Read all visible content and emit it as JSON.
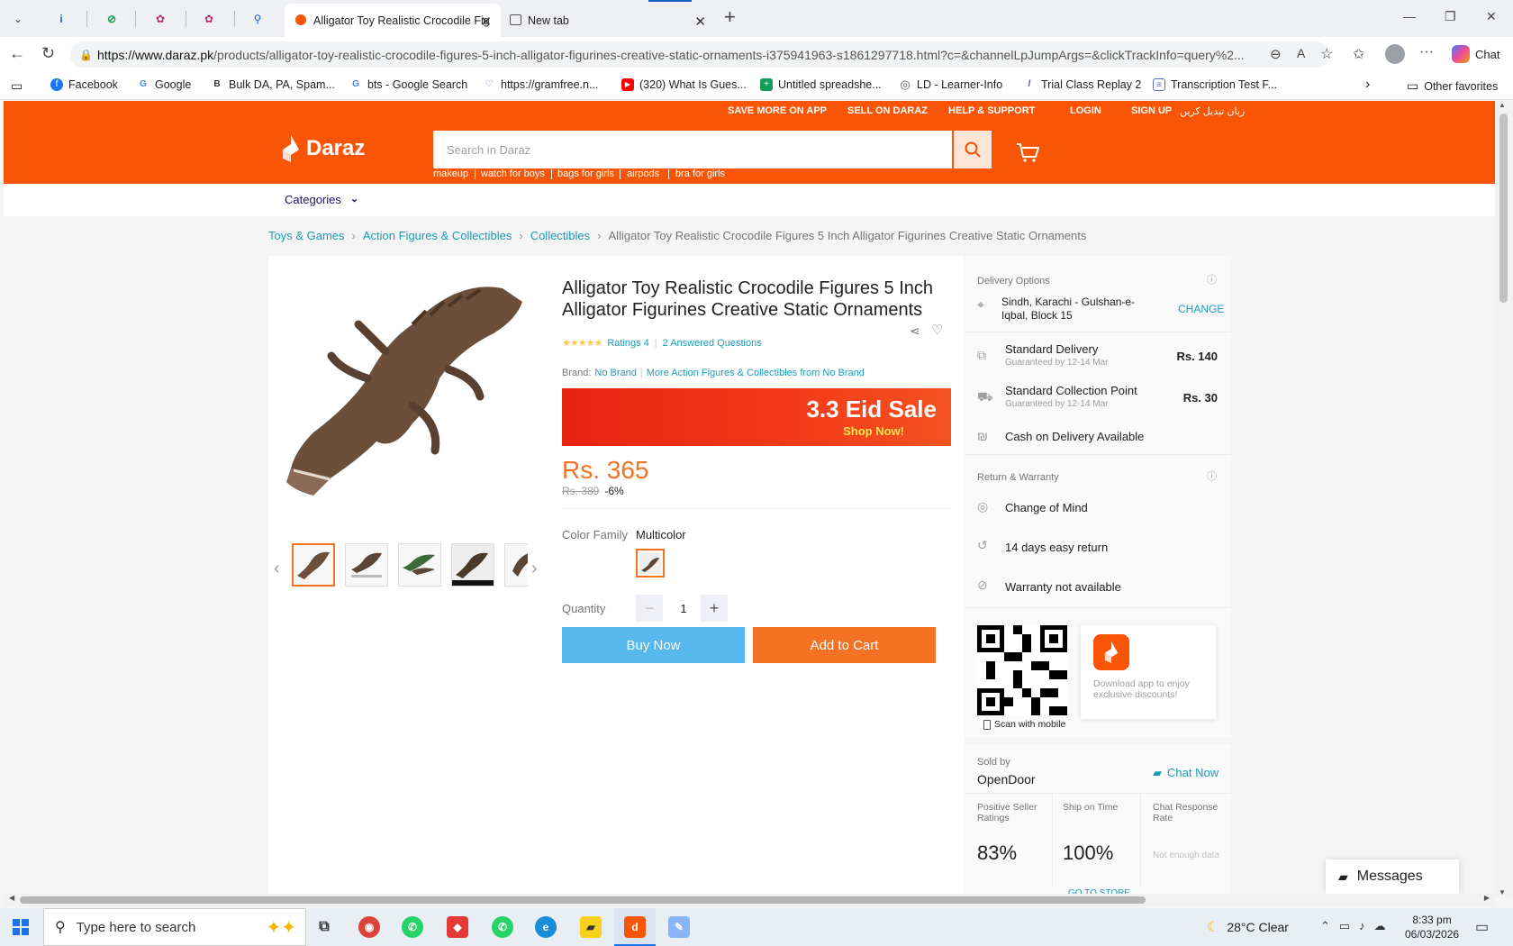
{
  "browser": {
    "tabs": [
      {
        "label": "Alligator Toy Realistic Crocodile Fig",
        "active": true
      },
      {
        "label": "New tab",
        "active": false
      }
    ],
    "url_host": "https://www.daraz.pk",
    "url_path": "/products/alligator-toy-realistic-crocodile-figures-5-inch-alligator-figurines-creative-static-ornaments-i375941963-s1861297718.html?c=&channelLpJumpArgs=&clickTrackInfo=query%2...",
    "chat_label": "Chat",
    "bookmarks": [
      {
        "label": "Facebook",
        "color": "#1877f2",
        "glyph": "f"
      },
      {
        "label": "Google",
        "color": "#4285f4",
        "glyph": "G"
      },
      {
        "label": "Bulk DA, PA, Spam...",
        "color": "#333333",
        "glyph": "B"
      },
      {
        "label": "bts - Google Search",
        "color": "#4285f4",
        "glyph": "G"
      },
      {
        "label": "https://gramfree.n...",
        "color": "#7b4fe0",
        "glyph": "g"
      },
      {
        "label": "(320) What Is Gues...",
        "color": "#ff0000",
        "glyph": "▶"
      },
      {
        "label": "Untitled spreadshe...",
        "color": "#0f9d58",
        "glyph": "+"
      },
      {
        "label": "LD - Learner-Info",
        "color": "#555555",
        "glyph": "◎"
      },
      {
        "label": "Trial Class Replay 2",
        "color": "#3949ab",
        "glyph": "/"
      },
      {
        "label": "Transcription Test F...",
        "color": "#5c6bc0",
        "glyph": "≡"
      }
    ],
    "other_favorites": "Other favorites"
  },
  "site": {
    "top_links": [
      "SAVE MORE ON APP",
      "SELL ON DARAZ",
      "HELP & SUPPORT",
      "LOGIN",
      "SIGN UP",
      "زبان تبدیل کریں"
    ],
    "logo": "Daraz",
    "search_placeholder": "Search in Daraz",
    "suggestions": [
      "makeup",
      "watch for boys",
      "bags for girls",
      "airpods",
      "bra for girls"
    ],
    "categories_label": "Categories",
    "brand_color": "#f85606"
  },
  "breadcrumb": {
    "links": [
      "Toys & Games",
      "Action Figures & Collectibles",
      "Collectibles"
    ],
    "current": "Alligator Toy Realistic Crocodile Figures 5 Inch Alligator Figurines Creative Static Ornaments"
  },
  "product": {
    "title": "Alligator Toy Realistic Crocodile Figures 5 Inch Alligator Figurines Creative Static Ornaments",
    "ratings": "Ratings 4",
    "answered": "2 Answered Questions",
    "brand_label": "Brand:",
    "brand": "No Brand",
    "more_from": "More Action Figures & Collectibles from No Brand",
    "banner_title": "3.3 Eid Sale",
    "banner_sub": "Shop Now!",
    "price": "Rs. 365",
    "old_price": "Rs. 389",
    "discount": "-6%",
    "color_label": "Color Family",
    "color_value": "Multicolor",
    "quantity_label": "Quantity",
    "quantity": "1",
    "buy_now": "Buy Now",
    "add_to_cart": "Add to Cart"
  },
  "delivery": {
    "title": "Delivery Options",
    "location": "Sindh, Karachi - Gulshan-e-Iqbal, Block 15",
    "change": "CHANGE",
    "standard": "Standard Delivery",
    "standard_sub": "Guaranteed by 12-14 Mar",
    "standard_price": "Rs. 140",
    "collection": "Standard Collection Point",
    "collection_sub": "Guaranteed by 12-14 Mar",
    "collection_price": "Rs. 30",
    "cod": "Cash on Delivery Available",
    "return_title": "Return & Warranty",
    "change_of_mind": "Change of Mind",
    "easy_return": "14 days easy return",
    "warranty": "Warranty not available",
    "app_text": "Download app to enjoy exclusive discounts!",
    "scan": "Scan with mobile",
    "sold_by": "Sold by",
    "seller": "OpenDoor",
    "chat_now": "Chat Now",
    "m1_label": "Positive Seller Ratings",
    "m1_value": "83%",
    "m2_label": "Ship on Time",
    "m2_value": "100%",
    "m3_label": "Chat Response Rate",
    "m3_value": "Not enough data",
    "go_store": "GO TO STORE"
  },
  "messages": "Messages",
  "taskbar": {
    "search": "Type here to search",
    "weather": "28°C  Clear",
    "time": "8:33 pm",
    "date": "06/03/2026"
  }
}
